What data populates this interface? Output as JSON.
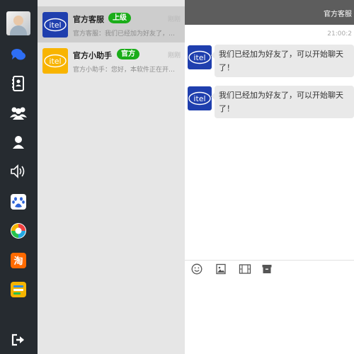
{
  "sidebar": {
    "items": [
      {
        "icon": "chat-icon",
        "color": "#2e6ef4"
      },
      {
        "icon": "contacts-book-icon",
        "color": "#ffffff"
      },
      {
        "icon": "group-icon",
        "color": "#ffffff"
      },
      {
        "icon": "person-icon",
        "color": "#ffffff"
      },
      {
        "icon": "speaker-icon",
        "color": "#ffffff"
      },
      {
        "icon": "baidu-paw-icon",
        "color": "#2f64d8"
      },
      {
        "icon": "video-app-icon",
        "color": "#22a7e2"
      },
      {
        "icon": "taobao-icon",
        "color": "#ff6a00"
      },
      {
        "icon": "notes-app-icon",
        "color": "#f5b400"
      },
      {
        "icon": "logout-icon",
        "color": "#ffffff"
      }
    ]
  },
  "conversations": [
    {
      "name": "官方客服",
      "badge": "上级",
      "time": "刚刚",
      "preview": "官方客服：我们已经加为好友了，可以开始聊天了！",
      "logo_color": "#1f3fae"
    },
    {
      "name": "官方小助手",
      "badge": "官方",
      "time": "刚刚",
      "preview": "官方小助手：您好，本软件正在开发中，敬请期待",
      "logo_color": "#f8b400"
    }
  ],
  "logo_text": "itel",
  "chat": {
    "title": "官方客服",
    "timestamp": "21:00:2",
    "messages": [
      {
        "text": "我们已经加为好友了，可以开始聊天了！"
      },
      {
        "text": "我们已经加为好友了，可以开始聊天了！"
      }
    ]
  },
  "toolbar": {
    "tools": [
      "emoji-icon",
      "image-icon",
      "video-icon",
      "archive-icon"
    ]
  },
  "colors": {
    "rail_bg": "#262b30",
    "list_bg": "#e6e6e6",
    "active_row": "#cdcdcd",
    "header_bg": "#5d5d5d",
    "badge": "#1aad19"
  }
}
